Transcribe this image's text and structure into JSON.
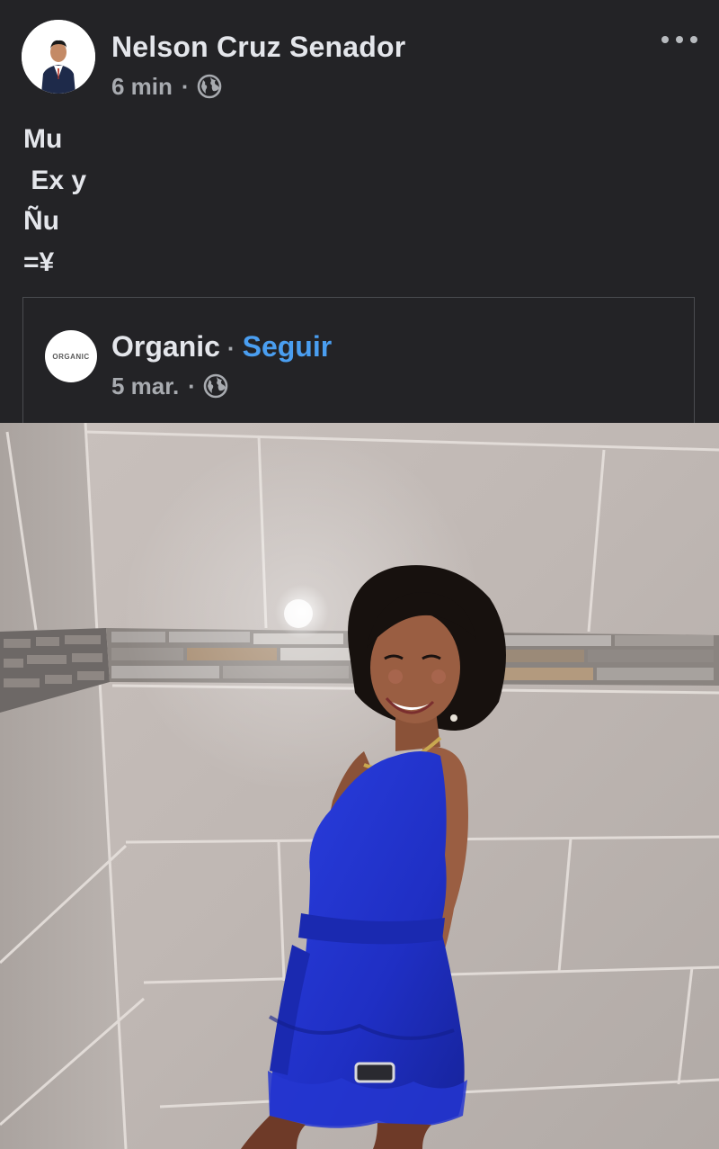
{
  "post": {
    "author": "Nelson Cruz Senador",
    "timestamp": "6 min",
    "separator": "·",
    "privacy_icon": "globe-icon",
    "menu_icon": "more-horizontal-icon",
    "text": "Mu\n Ex y\nÑu\n=¥"
  },
  "shared": {
    "page_name": "Organic",
    "separator": "·",
    "follow_label": "Seguir",
    "timestamp": "5 mar.",
    "privacy_icon": "globe-icon",
    "avatar_logo_text": "ORGANIC"
  },
  "colors": {
    "background": "#232326",
    "text_primary": "#e4e6eb",
    "text_secondary": "#a8abb0",
    "link": "#4a9ef0"
  }
}
